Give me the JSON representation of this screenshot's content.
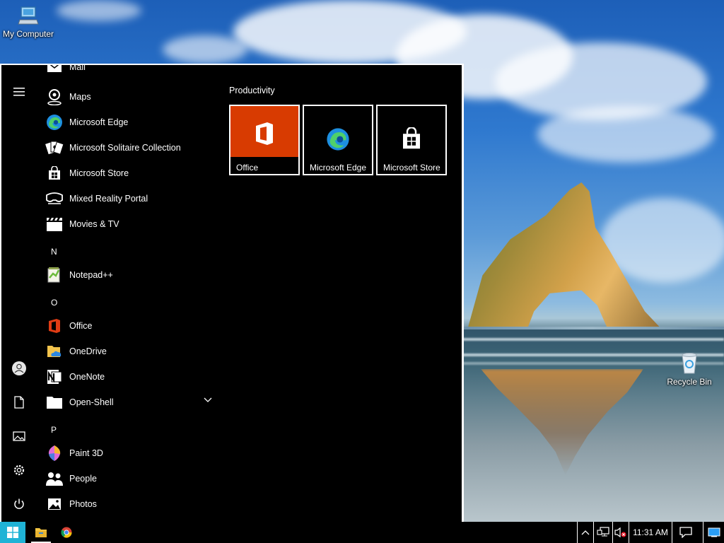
{
  "desktop": {
    "icons": [
      {
        "label": "My Computer",
        "icon": "computer-icon"
      },
      {
        "label": "Recycle Bin",
        "icon": "recycle-bin-icon"
      }
    ]
  },
  "start_menu": {
    "rail": [
      {
        "icon": "hamburger-menu-icon"
      },
      {
        "icon": "user-account-icon"
      },
      {
        "icon": "documents-icon"
      },
      {
        "icon": "pictures-icon"
      },
      {
        "icon": "settings-gear-icon"
      },
      {
        "icon": "power-icon"
      }
    ],
    "apps": [
      {
        "label": "Mail",
        "icon": "mail-icon"
      },
      {
        "label": "Maps",
        "icon": "maps-icon"
      },
      {
        "label": "Microsoft Edge",
        "icon": "edge-icon"
      },
      {
        "label": "Microsoft Solitaire Collection",
        "icon": "cards-icon"
      },
      {
        "label": "Microsoft Store",
        "icon": "store-bag-icon"
      },
      {
        "label": "Mixed Reality Portal",
        "icon": "headset-icon"
      },
      {
        "label": "Movies & TV",
        "icon": "clapperboard-icon"
      },
      {
        "label": "Notepad++",
        "icon": "notepad-plus-icon"
      },
      {
        "label": "Office",
        "icon": "office-icon"
      },
      {
        "label": "OneDrive",
        "icon": "onedrive-icon"
      },
      {
        "label": "OneNote",
        "icon": "onenote-icon"
      },
      {
        "label": "Open-Shell",
        "icon": "folder-icon"
      },
      {
        "label": "Paint 3D",
        "icon": "paint-3d-icon"
      },
      {
        "label": "People",
        "icon": "people-icon"
      },
      {
        "label": "Photos",
        "icon": "photos-icon"
      }
    ],
    "letters": [
      "N",
      "O",
      "P"
    ],
    "tiles_group_title": "Productivity",
    "tiles": [
      {
        "label": "Office",
        "icon": "office-icon",
        "bg": "#d83b01"
      },
      {
        "label": "Microsoft Edge",
        "icon": "edge-icon",
        "bg": "#000000"
      },
      {
        "label": "Microsoft Store",
        "icon": "store-bag-icon",
        "bg": "#000000"
      }
    ]
  },
  "taskbar": {
    "start_icon": "windows-logo-icon",
    "pinned": [
      {
        "name": "File Explorer",
        "icon": "file-explorer-icon"
      },
      {
        "name": "Chrome",
        "icon": "chrome-icon"
      }
    ],
    "tray": {
      "overflow_icon": "chevron-up-icon",
      "network_icon": "network-icon",
      "volume_icon": "volume-muted-icon",
      "clock": "11:31 AM",
      "notifications_icon": "action-center-icon",
      "show_desktop_icon": "show-desktop-icon"
    }
  },
  "colors": {
    "accent": "#0078d7",
    "office_tile": "#d83b01",
    "menu_bg": "#000000",
    "highlight_text": "#ffffff"
  }
}
